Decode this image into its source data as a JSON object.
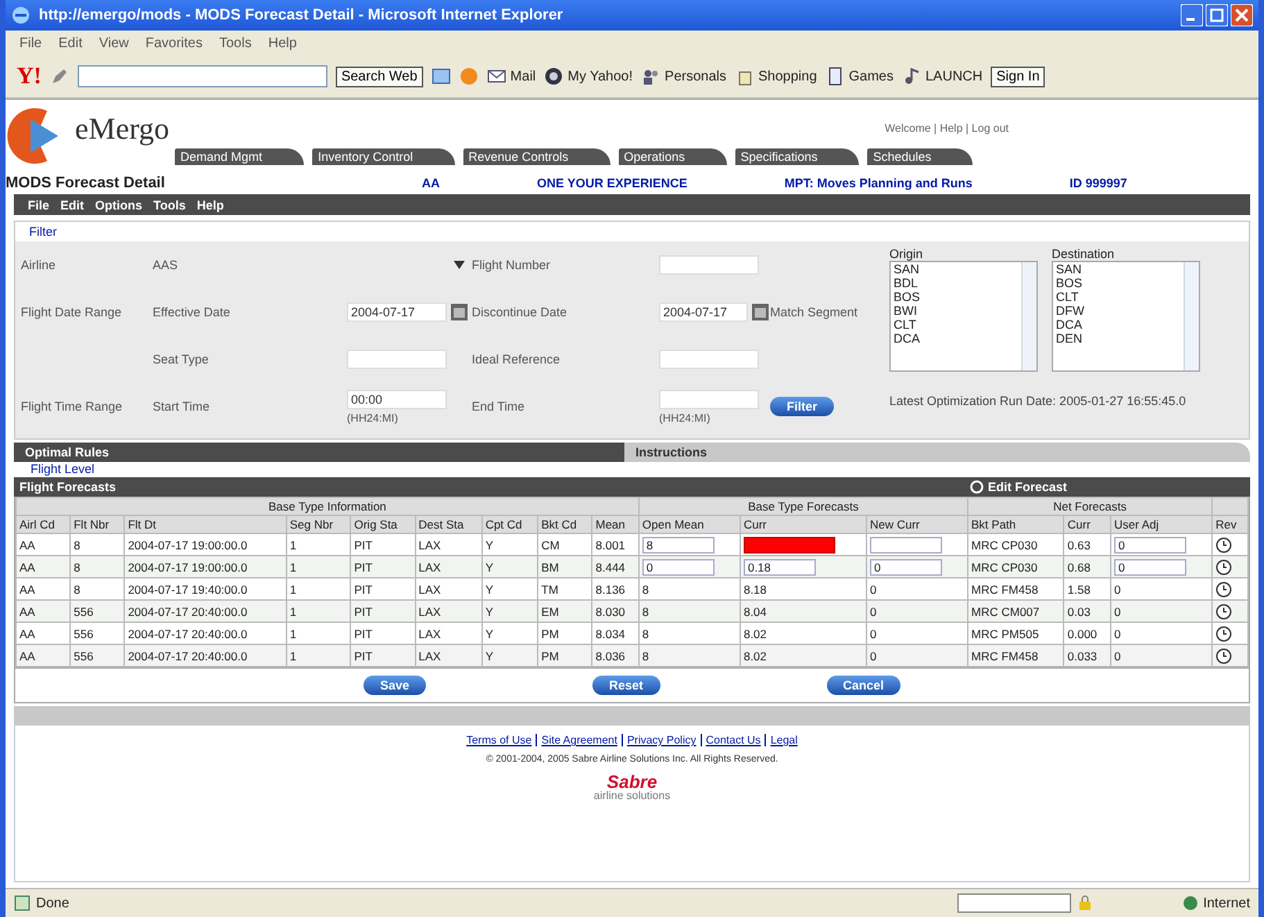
{
  "window": {
    "title": "http://emergo/mods - MODS Forecast Detail - Microsoft Internet Explorer"
  },
  "menu_bar": [
    "File",
    "Edit",
    "View",
    "Favorites",
    "Tools",
    "Help"
  ],
  "toolbar": {
    "logo": "Y!",
    "search_button": "Search Web",
    "items": [
      {
        "label": "Mail",
        "kind": "mail"
      },
      {
        "label": "My Yahoo!",
        "kind": "home"
      },
      {
        "label": "Personals",
        "kind": "people"
      },
      {
        "label": "Shopping",
        "kind": "bag"
      },
      {
        "label": "Games",
        "kind": "games"
      },
      {
        "label": "LAUNCH",
        "kind": "music"
      }
    ],
    "sign_in": "Sign In"
  },
  "app": {
    "logo": "eMergo",
    "user_links": "Welcome | Help | Log out",
    "tabs": [
      "Demand Mgmt",
      "Inventory Control",
      "Revenue Controls",
      "Operations",
      "Specifications",
      "Schedules"
    ]
  },
  "page": {
    "title": "MODS Forecast Detail",
    "info": [
      "AA",
      "ONE YOUR EXPERIENCE",
      "MPT: Moves Planning and Runs",
      "ID 999997"
    ]
  },
  "action_menu": [
    "File",
    "Edit",
    "Options",
    "Tools",
    "Help"
  ],
  "filter": {
    "link": "Filter",
    "airline": {
      "label": "Airline",
      "value": "AAS"
    },
    "flight_number": {
      "label": "Flight Number"
    },
    "date_range": {
      "label": "Flight Date Range",
      "effective_label": "Effective Date",
      "effective": "2004-07-17",
      "discontinue_label": "Discontinue Date",
      "discontinue": "2004-07-17",
      "match_label": "Match Segment"
    },
    "seat_type": {
      "label": "Seat Type"
    },
    "ideal_reference": {
      "label": "Ideal Reference"
    },
    "time_range": {
      "label": "Flight Time Range",
      "start_label": "Start Time",
      "start": "00:00",
      "start_hint": "(HH24:MI)",
      "end_label": "End Time",
      "end_hint": "(HH24:MI)"
    },
    "button": "Filter",
    "origin": {
      "label": "Origin",
      "items": [
        "SAN",
        "BDL",
        "BOS",
        "BWI",
        "CLT",
        "DCA"
      ]
    },
    "destination": {
      "label": "Destination",
      "items": [
        "SAN",
        "BOS",
        "CLT",
        "DFW",
        "DCA",
        "DEN"
      ]
    },
    "latest_run": "Latest Optimization Run Date: 2005-01-27 16:55:45.0"
  },
  "section_tabs": [
    {
      "label": "Optimal Rules",
      "selected": true
    },
    {
      "label": "Instructions",
      "selected": false
    }
  ],
  "flight_level_link": "Flight Level",
  "forecasts": {
    "title": "Flight Forecasts",
    "edit_label": "Edit Forecast",
    "groups": [
      {
        "label": "Base Type Information",
        "columns": [
          {
            "label": "Airl Cd",
            "kind": "text"
          },
          {
            "label": "Flt Nbr",
            "kind": "text"
          },
          {
            "label": "Flt Dt",
            "kind": "text"
          },
          {
            "label": "Seg Nbr",
            "kind": "text"
          },
          {
            "label": "Orig Sta",
            "kind": "text"
          },
          {
            "label": "Dest Sta",
            "kind": "text"
          },
          {
            "label": "Cpt Cd",
            "kind": "text"
          },
          {
            "label": "Bkt Cd",
            "kind": "text"
          },
          {
            "label": "Mean",
            "kind": "text"
          }
        ]
      },
      {
        "label": "Base Type Forecasts",
        "columns": [
          {
            "label": "Open Mean",
            "kind": "input"
          },
          {
            "label": "Curr",
            "kind": "input"
          },
          {
            "label": "New Curr",
            "kind": "input"
          }
        ]
      },
      {
        "label": "Net Forecasts",
        "columns": [
          {
            "label": "Bkt Path",
            "kind": "text"
          },
          {
            "label": "Curr",
            "kind": "text"
          },
          {
            "label": "User Adj",
            "kind": "input"
          }
        ]
      },
      {
        "columns": [
          {
            "label": "Rev",
            "kind": "icon"
          }
        ]
      }
    ],
    "rows": [
      {
        "editable": true,
        "error": true,
        "cells": [
          "AA",
          "8",
          "2004-07-17 19:00:00.0",
          "1",
          "PIT",
          "LAX",
          "Y",
          "CM",
          "8.001",
          "8",
          null,
          null,
          "MRC CP030",
          "0.63",
          "0"
        ]
      },
      {
        "editable": true,
        "error": false,
        "cells": [
          "AA",
          "8",
          "2004-07-17 19:00:00.0",
          "1",
          "PIT",
          "LAX",
          "Y",
          "BM",
          "8.444",
          "0",
          "0.18",
          "0",
          "MRC CP030",
          "0.68",
          "0"
        ]
      },
      {
        "editable": false,
        "error": false,
        "cells": [
          "AA",
          "8",
          "2004-07-17 19:40:00.0",
          "1",
          "PIT",
          "LAX",
          "Y",
          "TM",
          "8.136",
          "8",
          "8.18",
          "0",
          "MRC FM458",
          "1.58",
          "0"
        ]
      },
      {
        "editable": false,
        "error": false,
        "cells": [
          "AA",
          "556",
          "2004-07-17 20:40:00.0",
          "1",
          "PIT",
          "LAX",
          "Y",
          "EM",
          "8.030",
          "8",
          "8.04",
          "0",
          "MRC CM007",
          "0.03",
          "0"
        ]
      },
      {
        "editable": false,
        "error": false,
        "cells": [
          "AA",
          "556",
          "2004-07-17 20:40:00.0",
          "1",
          "PIT",
          "LAX",
          "Y",
          "PM",
          "8.034",
          "8",
          "8.02",
          "0",
          "MRC PM505",
          "0.000",
          "0"
        ]
      },
      {
        "editable": false,
        "error": false,
        "cells": [
          "AA",
          "556",
          "2004-07-17 20:40:00.0",
          "1",
          "PIT",
          "LAX",
          "Y",
          "PM",
          "8.036",
          "8",
          "8.02",
          "0",
          "MRC FM458",
          "0.033",
          "0"
        ]
      }
    ]
  },
  "buttons": [
    "Save",
    "Reset",
    "Cancel"
  ],
  "footer": {
    "links": [
      "Terms of Use",
      "Site Agreement",
      "Privacy Policy",
      "Contact Us",
      "Legal"
    ],
    "copyright": "© 2001-2004, 2005 Sabre Airline Solutions Inc. All Rights Reserved.",
    "logo": "Sabre",
    "tagline": "airline solutions"
  },
  "status_bar": {
    "text": "Done",
    "zone": "Internet"
  }
}
